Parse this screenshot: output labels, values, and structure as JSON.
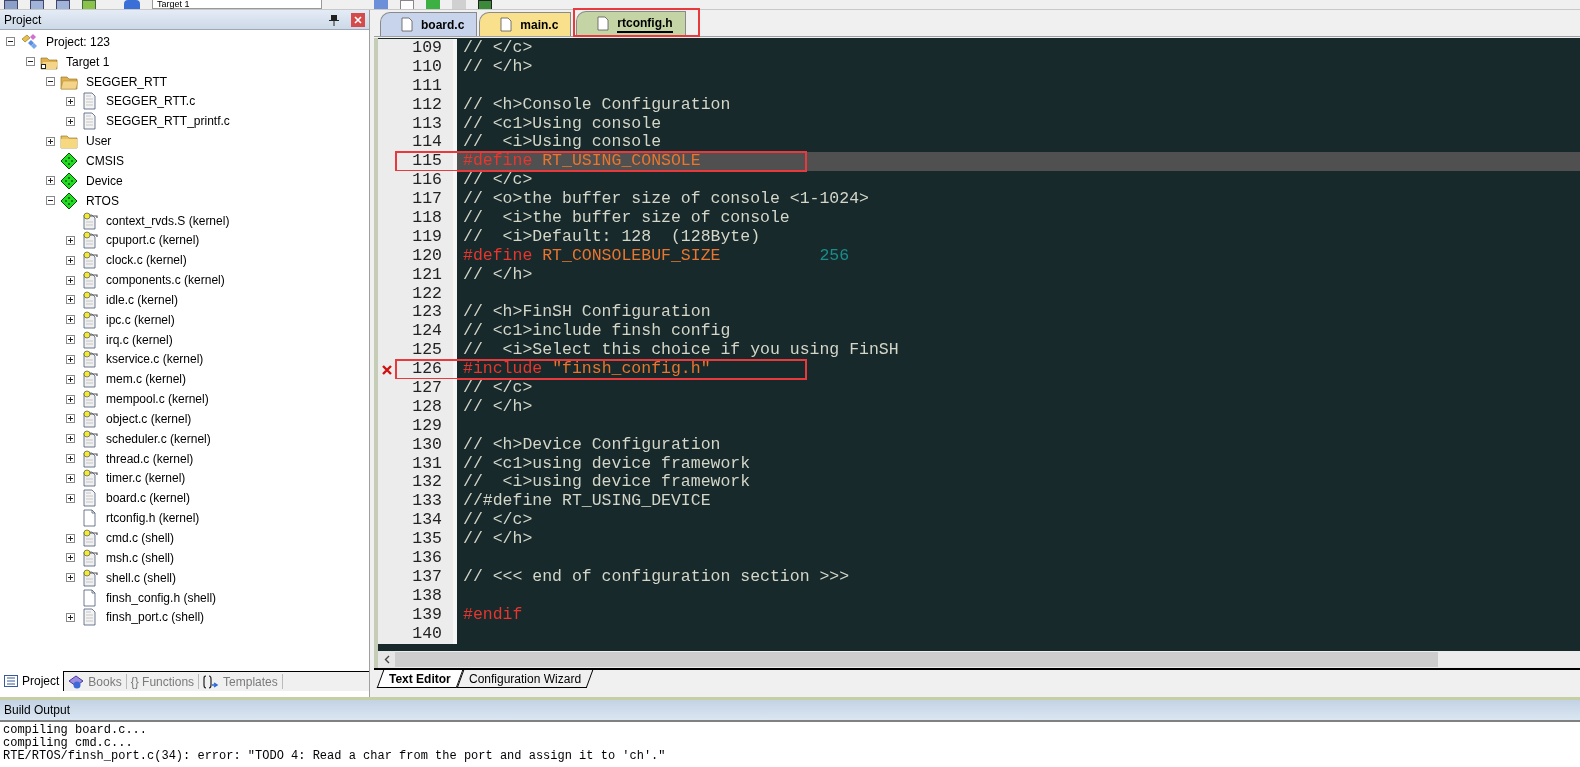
{
  "toolbar": {
    "target": "Target 1"
  },
  "project_panel": {
    "title": "Project",
    "tree": [
      {
        "label": "Project: 123",
        "kind": "project",
        "expanded": true,
        "children": [
          {
            "label": "Target 1",
            "kind": "target",
            "expanded": true,
            "children": [
              {
                "label": "SEGGER_RTT",
                "kind": "folder_open",
                "expanded": true,
                "children": [
                  {
                    "label": "SEGGER_RTT.c",
                    "kind": "file",
                    "expanded": false
                  },
                  {
                    "label": "SEGGER_RTT_printf.c",
                    "kind": "file",
                    "expanded": false
                  }
                ]
              },
              {
                "label": "User",
                "kind": "folder",
                "expanded": false
              },
              {
                "label": "CMSIS",
                "kind": "component"
              },
              {
                "label": "Device",
                "kind": "component",
                "expanded": false
              },
              {
                "label": "RTOS",
                "kind": "component",
                "expanded": true,
                "children": [
                  {
                    "label": "context_rvds.S (kernel)",
                    "kind": "locked_file"
                  },
                  {
                    "label": "cpuport.c (kernel)",
                    "kind": "locked_file",
                    "expanded": false
                  },
                  {
                    "label": "clock.c (kernel)",
                    "kind": "locked_file",
                    "expanded": false
                  },
                  {
                    "label": "components.c (kernel)",
                    "kind": "locked_file",
                    "expanded": false
                  },
                  {
                    "label": "idle.c (kernel)",
                    "kind": "locked_file",
                    "expanded": false
                  },
                  {
                    "label": "ipc.c (kernel)",
                    "kind": "locked_file",
                    "expanded": false
                  },
                  {
                    "label": "irq.c (kernel)",
                    "kind": "locked_file",
                    "expanded": false
                  },
                  {
                    "label": "kservice.c (kernel)",
                    "kind": "locked_file",
                    "expanded": false
                  },
                  {
                    "label": "mem.c (kernel)",
                    "kind": "locked_file",
                    "expanded": false
                  },
                  {
                    "label": "mempool.c (kernel)",
                    "kind": "locked_file",
                    "expanded": false
                  },
                  {
                    "label": "object.c (kernel)",
                    "kind": "locked_file",
                    "expanded": false
                  },
                  {
                    "label": "scheduler.c (kernel)",
                    "kind": "locked_file",
                    "expanded": false
                  },
                  {
                    "label": "thread.c (kernel)",
                    "kind": "locked_file",
                    "expanded": false
                  },
                  {
                    "label": "timer.c (kernel)",
                    "kind": "locked_file",
                    "expanded": false
                  },
                  {
                    "label": "board.c (kernel)",
                    "kind": "file",
                    "expanded": false
                  },
                  {
                    "label": "rtconfig.h (kernel)",
                    "kind": "header"
                  },
                  {
                    "label": "cmd.c (shell)",
                    "kind": "locked_file",
                    "expanded": false
                  },
                  {
                    "label": "msh.c (shell)",
                    "kind": "locked_file",
                    "expanded": false
                  },
                  {
                    "label": "shell.c (shell)",
                    "kind": "locked_file",
                    "expanded": false
                  },
                  {
                    "label": "finsh_config.h (shell)",
                    "kind": "header"
                  },
                  {
                    "label": "finsh_port.c (shell)",
                    "kind": "file",
                    "expanded": false
                  }
                ]
              }
            ]
          }
        ]
      }
    ],
    "tabs": [
      {
        "label": "Project",
        "kind": "project",
        "selected": true
      },
      {
        "label": "Books",
        "kind": "books",
        "selected": false
      },
      {
        "label": "{} Functions",
        "kind": "plain",
        "selected": false
      },
      {
        "label": "Templates",
        "kind": "templates",
        "selected": false
      }
    ]
  },
  "editor": {
    "tabs": [
      {
        "label": "board.c",
        "color": "#c8d4ec",
        "selected": false,
        "annotated": false
      },
      {
        "label": "main.c",
        "color": "#f8e08c",
        "selected": false,
        "annotated": false
      },
      {
        "label": "rtconfig.h",
        "color": "#c4d4a4",
        "selected": true,
        "annotated": true
      }
    ],
    "lines": [
      {
        "number": "109",
        "tokens": [
          {
            "kind": "comment",
            "text": "// </c>"
          }
        ]
      },
      {
        "number": "110",
        "tokens": [
          {
            "kind": "comment",
            "text": "// </h>"
          }
        ]
      },
      {
        "number": "111"
      },
      {
        "number": "112",
        "tokens": [
          {
            "kind": "comment",
            "text": "// <h>Console Configuration"
          }
        ]
      },
      {
        "number": "113",
        "tokens": [
          {
            "kind": "comment",
            "text": "// <c1>Using console"
          }
        ]
      },
      {
        "number": "114",
        "tokens": [
          {
            "kind": "comment",
            "text": "//  <i>Using console"
          }
        ]
      },
      {
        "number": "115",
        "current": true,
        "annotated": true,
        "tokens": [
          {
            "kind": "directive",
            "text": "#define"
          },
          {
            "kind": "identifier",
            "text": " RT_USING_CONSOLE"
          }
        ]
      },
      {
        "number": "116",
        "tokens": [
          {
            "kind": "comment",
            "text": "// </c>"
          }
        ]
      },
      {
        "number": "117",
        "tokens": [
          {
            "kind": "comment",
            "text": "// <o>the buffer size of console <1-1024>"
          }
        ]
      },
      {
        "number": "118",
        "tokens": [
          {
            "kind": "comment",
            "text": "//  <i>the buffer size of console"
          }
        ]
      },
      {
        "number": "119",
        "tokens": [
          {
            "kind": "comment",
            "text": "//  <i>Default: 128  (128Byte)"
          }
        ]
      },
      {
        "number": "120",
        "tokens": [
          {
            "kind": "directive",
            "text": "#define"
          },
          {
            "kind": "identifier",
            "text": " RT_CONSOLEBUF_SIZE          "
          },
          {
            "kind": "number",
            "text": "256"
          }
        ]
      },
      {
        "number": "121",
        "tokens": [
          {
            "kind": "comment",
            "text": "// </h>"
          }
        ]
      },
      {
        "number": "122"
      },
      {
        "number": "123",
        "tokens": [
          {
            "kind": "comment",
            "text": "// <h>FinSH Configuration"
          }
        ]
      },
      {
        "number": "124",
        "tokens": [
          {
            "kind": "comment",
            "text": "// <c1>include finsh config"
          }
        ]
      },
      {
        "number": "125",
        "tokens": [
          {
            "kind": "comment",
            "text": "//  <i>Select this choice if you using FinSH"
          }
        ]
      },
      {
        "number": "126",
        "error": true,
        "annotated": true,
        "tokens": [
          {
            "kind": "directive",
            "text": "#include "
          },
          {
            "kind": "string",
            "text": "\"finsh_config.h\""
          }
        ]
      },
      {
        "number": "127",
        "tokens": [
          {
            "kind": "comment",
            "text": "// </c>"
          }
        ]
      },
      {
        "number": "128",
        "tokens": [
          {
            "kind": "comment",
            "text": "// </h>"
          }
        ]
      },
      {
        "number": "129"
      },
      {
        "number": "130",
        "tokens": [
          {
            "kind": "comment",
            "text": "// <h>Device Configuration"
          }
        ]
      },
      {
        "number": "131",
        "tokens": [
          {
            "kind": "comment",
            "text": "// <c1>using device framework"
          }
        ]
      },
      {
        "number": "132",
        "tokens": [
          {
            "kind": "comment",
            "text": "//  <i>using device framework"
          }
        ]
      },
      {
        "number": "133",
        "tokens": [
          {
            "kind": "comment",
            "text": "//#define RT_USING_DEVICE"
          }
        ]
      },
      {
        "number": "134",
        "tokens": [
          {
            "kind": "comment",
            "text": "// </c>"
          }
        ]
      },
      {
        "number": "135",
        "tokens": [
          {
            "kind": "comment",
            "text": "// </h>"
          }
        ]
      },
      {
        "number": "136"
      },
      {
        "number": "137",
        "tokens": [
          {
            "kind": "comment",
            "text": "// <<< end of configuration section >>>"
          }
        ]
      },
      {
        "number": "138"
      },
      {
        "number": "139",
        "tokens": [
          {
            "kind": "directive",
            "text": "#endif"
          }
        ]
      },
      {
        "number": "140"
      }
    ],
    "bottom_tabs": [
      {
        "label": "Text Editor",
        "selected": true
      },
      {
        "label": "Configuration Wizard",
        "selected": false
      }
    ]
  },
  "build_output": {
    "title": "Build Output",
    "lines": [
      "compiling board.c...",
      "compiling cmd.c...",
      "RTE/RTOS/finsh_port.c(34): error: \"TODO 4: Read a char from the port and assign it to 'ch'.\""
    ]
  }
}
